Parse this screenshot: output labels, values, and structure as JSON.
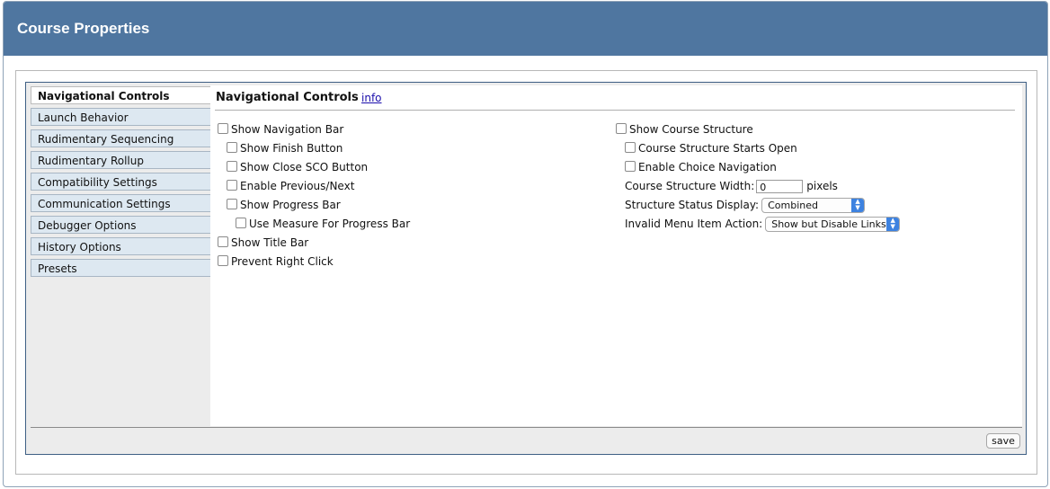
{
  "header": {
    "title": "Course Properties"
  },
  "sidebar": {
    "tabs": [
      {
        "label": "Navigational Controls",
        "active": true
      },
      {
        "label": "Launch Behavior"
      },
      {
        "label": "Rudimentary Sequencing"
      },
      {
        "label": "Rudimentary Rollup"
      },
      {
        "label": "Compatibility Settings"
      },
      {
        "label": "Communication Settings"
      },
      {
        "label": "Debugger Options"
      },
      {
        "label": "History Options"
      },
      {
        "label": "Presets"
      }
    ]
  },
  "content": {
    "title": "Navigational Controls",
    "info_link": "info",
    "left_options": [
      {
        "label": "Show Navigation Bar",
        "checked": false
      },
      {
        "label": "Show Finish Button",
        "checked": false
      },
      {
        "label": "Show Close SCO Button",
        "checked": false
      },
      {
        "label": "Enable Previous/Next",
        "checked": false
      },
      {
        "label": "Show Progress Bar",
        "checked": false
      },
      {
        "label": "Use Measure For Progress Bar",
        "checked": false
      },
      {
        "label": "Show Title Bar",
        "checked": false
      },
      {
        "label": "Prevent Right Click",
        "checked": false
      }
    ],
    "right_options": [
      {
        "label": "Show Course Structure",
        "checked": false
      },
      {
        "label": "Course Structure Starts Open",
        "checked": false
      },
      {
        "label": "Enable Choice Navigation",
        "checked": false
      }
    ],
    "structure_width": {
      "label": "Course Structure Width:",
      "value": "0",
      "unit": "pixels"
    },
    "status_display": {
      "label": "Structure Status Display:",
      "value": "Combined"
    },
    "invalid_action": {
      "label": "Invalid Menu Item Action:",
      "value": "Show but Disable Links"
    }
  },
  "footer": {
    "save_label": "save"
  }
}
